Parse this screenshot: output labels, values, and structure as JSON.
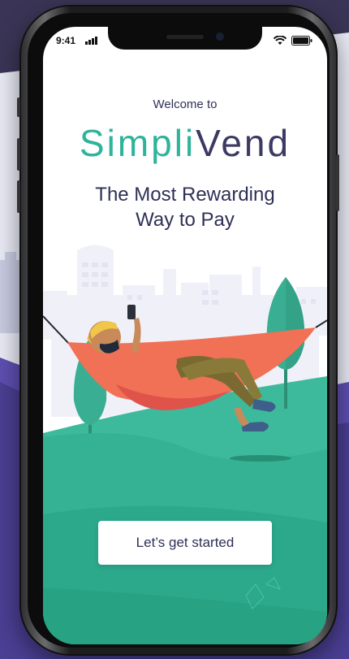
{
  "status_bar": {
    "time": "9:41"
  },
  "hero": {
    "welcome_text": "Welcome to",
    "brand_part1": "Simpli",
    "brand_part2": "Vend",
    "tagline_line1": "The Most Rewarding",
    "tagline_line2": "Way to Pay"
  },
  "cta": {
    "label": "Let’s get started"
  },
  "colors": {
    "brand_green": "#2fb39b",
    "brand_navy": "#3c3a63",
    "hammock": "#f07155",
    "ground": "#35b194",
    "ground_dark": "#27a283"
  },
  "illustration": "person relaxing in a hammock holding a phone, city skyline and trees in background"
}
